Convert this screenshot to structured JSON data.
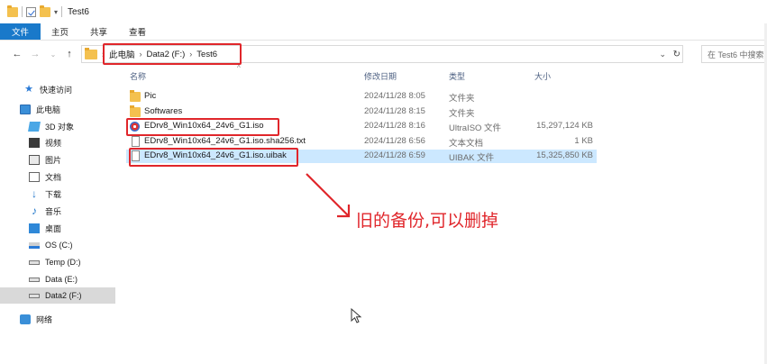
{
  "window": {
    "title": "Test6"
  },
  "ribbon": {
    "tabs": [
      "文件",
      "主页",
      "共享",
      "查看"
    ]
  },
  "address_bar": {
    "crumbs": [
      "此电脑",
      "Data2 (F:)",
      "Test6"
    ],
    "search_placeholder": "在 Test6 中搜索"
  },
  "sidebar": {
    "items": [
      {
        "label": "快速访问",
        "icon": "star-icon"
      },
      {
        "label": "此电脑",
        "icon": "computer-icon"
      },
      {
        "label": "3D 对象",
        "icon": "3d-objects-icon"
      },
      {
        "label": "视频",
        "icon": "video-icon"
      },
      {
        "label": "图片",
        "icon": "pictures-icon"
      },
      {
        "label": "文档",
        "icon": "documents-icon"
      },
      {
        "label": "下载",
        "icon": "download-icon"
      },
      {
        "label": "音乐",
        "icon": "music-icon"
      },
      {
        "label": "桌面",
        "icon": "desktop-icon"
      },
      {
        "label": "OS (C:)",
        "icon": "os-drive-icon"
      },
      {
        "label": "Temp (D:)",
        "icon": "drive-icon"
      },
      {
        "label": "Data (E:)",
        "icon": "drive-icon"
      },
      {
        "label": "Data2 (F:)",
        "icon": "drive-icon",
        "selected": true
      },
      {
        "label": "网络",
        "icon": "network-icon"
      }
    ]
  },
  "file_list": {
    "columns": {
      "name": "名称",
      "date": "修改日期",
      "type": "类型",
      "size": "大小"
    },
    "rows": [
      {
        "name": "Pic",
        "date": "2024/11/28 8:05",
        "type": "文件夹",
        "size": "",
        "icon": "folder-icon"
      },
      {
        "name": "Softwares",
        "date": "2024/11/28 8:15",
        "type": "文件夹",
        "size": "",
        "icon": "folder-icon"
      },
      {
        "name": "EDrv8_Win10x64_24v6_G1.iso",
        "date": "2024/11/28 8:16",
        "type": "UltraISO 文件",
        "size": "15,297,124 KB",
        "icon": "ultraiso-icon"
      },
      {
        "name": "EDrv8_Win10x64_24v6_G1.iso.sha256.txt",
        "date": "2024/11/28 6:56",
        "type": "文本文档",
        "size": "1 KB",
        "icon": "text-file-icon"
      },
      {
        "name": "EDrv8_Win10x64_24v6_G1.iso.uibak",
        "date": "2024/11/28 6:59",
        "type": "UIBAK 文件",
        "size": "15,325,850 KB",
        "icon": "file-icon",
        "selected": true
      }
    ]
  },
  "annotation": {
    "text": "旧的备份,可以删掉",
    "color": "#e0262b"
  }
}
